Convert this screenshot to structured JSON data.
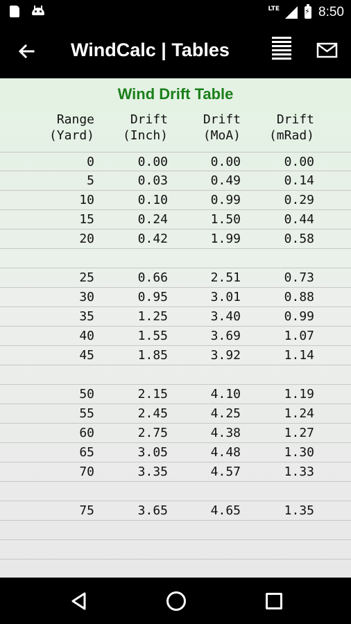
{
  "status_bar": {
    "network": "LTE",
    "time": "8:50"
  },
  "app_bar": {
    "title": "WindCalc | Tables"
  },
  "table": {
    "title": "Wind Drift Table",
    "headers": [
      {
        "line1": "Range",
        "line2": "(Yard)"
      },
      {
        "line1": "Drift",
        "line2": "(Inch)"
      },
      {
        "line1": "Drift",
        "line2": "(MoA)"
      },
      {
        "line1": "Drift",
        "line2": "(mRad)"
      }
    ],
    "rows": [
      [
        "0",
        "0.00",
        "0.00",
        "0.00"
      ],
      [
        "5",
        "0.03",
        "0.49",
        "0.14"
      ],
      [
        "10",
        "0.10",
        "0.99",
        "0.29"
      ],
      [
        "15",
        "0.24",
        "1.50",
        "0.44"
      ],
      [
        "20",
        "0.42",
        "1.99",
        "0.58"
      ],
      [
        "",
        "",
        "",
        ""
      ],
      [
        "25",
        "0.66",
        "2.51",
        "0.73"
      ],
      [
        "30",
        "0.95",
        "3.01",
        "0.88"
      ],
      [
        "35",
        "1.25",
        "3.40",
        "0.99"
      ],
      [
        "40",
        "1.55",
        "3.69",
        "1.07"
      ],
      [
        "45",
        "1.85",
        "3.92",
        "1.14"
      ],
      [
        "",
        "",
        "",
        ""
      ],
      [
        "50",
        "2.15",
        "4.10",
        "1.19"
      ],
      [
        "55",
        "2.45",
        "4.25",
        "1.24"
      ],
      [
        "60",
        "2.75",
        "4.38",
        "1.27"
      ],
      [
        "65",
        "3.05",
        "4.48",
        "1.30"
      ],
      [
        "70",
        "3.35",
        "4.57",
        "1.33"
      ],
      [
        "",
        "",
        "",
        ""
      ],
      [
        "75",
        "3.65",
        "4.65",
        "1.35"
      ],
      [
        "",
        "",
        "",
        ""
      ],
      [
        "",
        "",
        "",
        ""
      ]
    ]
  },
  "icons": {
    "back": "arrow-left-icon",
    "list": "list-lines-icon",
    "mail": "mail-icon",
    "nav_back": "triangle-back-icon",
    "nav_home": "circle-home-icon",
    "nav_recent": "square-recents-icon"
  }
}
